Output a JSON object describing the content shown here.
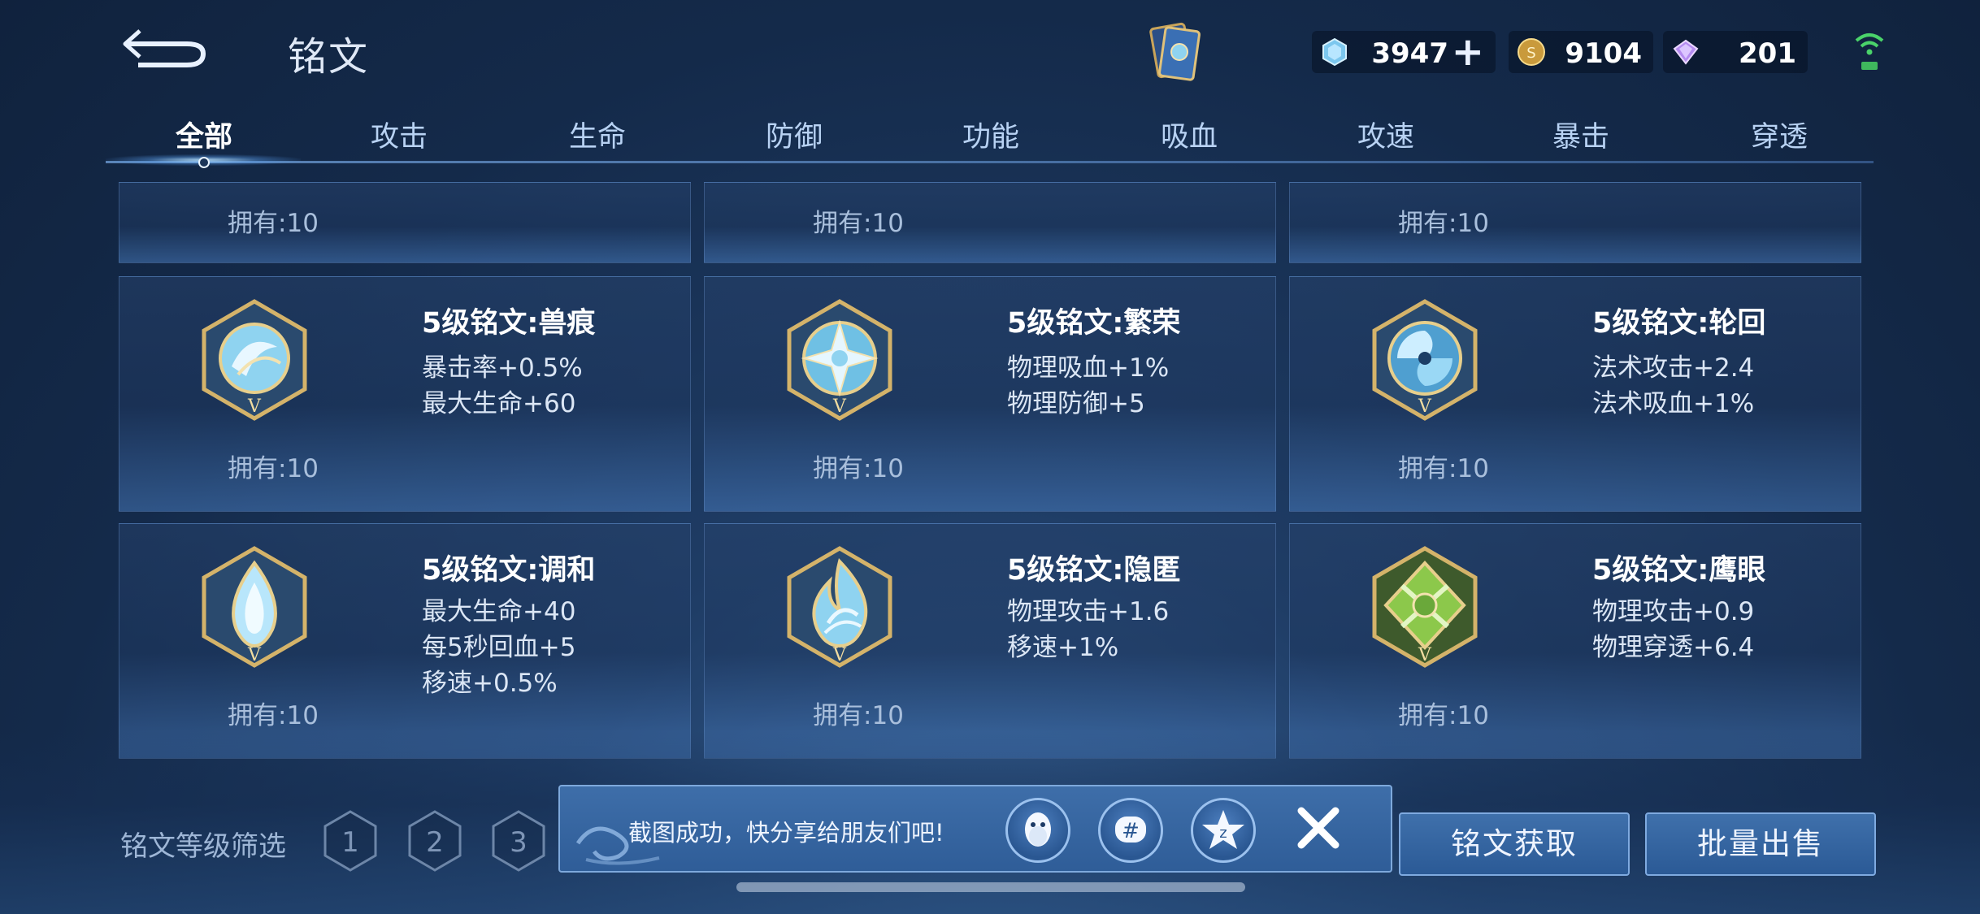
{
  "header": {
    "title": "铭文",
    "back_icon": "back-arrow-icon",
    "currencies": [
      {
        "icon": "diamond-gem-icon",
        "value": "3947",
        "has_plus": true
      },
      {
        "icon": "gold-coin-icon",
        "value": "9104"
      },
      {
        "icon": "purple-crystal-icon",
        "value": "201"
      }
    ]
  },
  "tabs": [
    {
      "label": "全部",
      "active": true
    },
    {
      "label": "攻击"
    },
    {
      "label": "生命"
    },
    {
      "label": "防御"
    },
    {
      "label": "功能"
    },
    {
      "label": "吸血"
    },
    {
      "label": "攻速"
    },
    {
      "label": "暴击"
    },
    {
      "label": "穿透"
    }
  ],
  "partial_row": [
    {
      "owned": "拥有:10"
    },
    {
      "owned": "拥有:10"
    },
    {
      "owned": "拥有:10"
    }
  ],
  "runes": [
    {
      "name": "5级铭文:兽痕",
      "stats": [
        "暴击率+0.5%",
        "最大生命+60"
      ],
      "owned": "拥有:10",
      "color": "blue"
    },
    {
      "name": "5级铭文:繁荣",
      "stats": [
        "物理吸血+1%",
        "物理防御+5"
      ],
      "owned": "拥有:10",
      "color": "blue"
    },
    {
      "name": "5级铭文:轮回",
      "stats": [
        "法术攻击+2.4",
        "法术吸血+1%"
      ],
      "owned": "拥有:10",
      "color": "blue"
    },
    {
      "name": "5级铭文:调和",
      "stats": [
        "最大生命+40",
        "每5秒回血+5",
        "移速+0.5%"
      ],
      "owned": "拥有:10",
      "color": "blue"
    },
    {
      "name": "5级铭文:隐匿",
      "stats": [
        "物理攻击+1.6",
        "移速+1%"
      ],
      "owned": "拥有:10",
      "color": "blue"
    },
    {
      "name": "5级铭文:鹰眼",
      "stats": [
        "物理攻击+0.9",
        "物理穿透+6.4"
      ],
      "owned": "拥有:10",
      "color": "green"
    }
  ],
  "filter": {
    "label": "铭文等级筛选",
    "levels": [
      "1",
      "2",
      "3"
    ]
  },
  "share": {
    "text": "截图成功，快分享给朋友们吧!"
  },
  "actions": {
    "obtain": "铭文获取",
    "sell": "批量出售"
  },
  "colors": {
    "accent": "#2f5d98",
    "gold": "#c9a45a",
    "rune_blue": "#8fd3f0",
    "rune_green": "#8cc84b"
  }
}
